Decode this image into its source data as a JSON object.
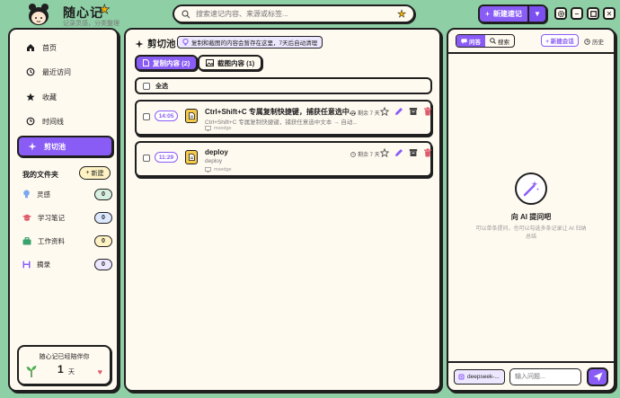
{
  "header": {
    "app_title": "随心记",
    "app_subtitle": "记录灵感，分类整理",
    "search_placeholder": "搜索速记内容、来源或标签...",
    "new_note_label": "新建速记"
  },
  "sidebar": {
    "nav": [
      {
        "label": "首页",
        "icon": "home-icon"
      },
      {
        "label": "最近访问",
        "icon": "clock-history-icon"
      },
      {
        "label": "收藏",
        "icon": "star-icon"
      },
      {
        "label": "时间线",
        "icon": "clock-icon"
      },
      {
        "label": "剪切池",
        "icon": "sparkle-icon",
        "active": true
      }
    ],
    "folders_title": "我的文件夹",
    "new_folder_label": "新建",
    "folders": [
      {
        "label": "灵感",
        "count": "0",
        "icon": "bulb-icon",
        "color": "#7aa8f0",
        "badge": "#d8f0e0"
      },
      {
        "label": "学习笔记",
        "count": "0",
        "icon": "cap-icon",
        "color": "#e05a6b",
        "badge": "#dde8ff"
      },
      {
        "label": "工作资料",
        "count": "0",
        "icon": "briefcase-icon",
        "color": "#3aa36b",
        "badge": "#fff3c4"
      },
      {
        "label": "摘录",
        "count": "0",
        "icon": "disk-icon",
        "color": "#8a5cf6",
        "badge": "#ede7ff"
      }
    ],
    "companion": {
      "title": "随心记已经陪伴你",
      "days": "1",
      "unit": "天"
    }
  },
  "clipboard": {
    "title": "剪切池",
    "notice": "复制和截图的内容会暂存在这里，7天后自动清理",
    "tabs": [
      {
        "label": "复制内容 (2)",
        "active": true
      },
      {
        "label": "截图内容 (1)",
        "active": false
      }
    ],
    "select_all": "全选",
    "items": [
      {
        "time": "14:05",
        "title": "Ctrl+Shift+C 专属复制快捷键，捕获任意选中...",
        "preview": "Ctrl+Shift+C 专属复制快捷键，捕获任意选中文本 → 自动...",
        "source": "msedge",
        "remaining": "剩余 7 天"
      },
      {
        "time": "11:29",
        "title": "deploy",
        "preview": "deploy",
        "source": "msedge",
        "remaining": "剩余 7 天"
      }
    ]
  },
  "assistant": {
    "tab_ask": "问答",
    "tab_search": "搜索",
    "new_chat": "+ 新建会话",
    "history": "历史",
    "empty_title": "向 AI 提问吧",
    "empty_desc": "可以单条提问，也可以勾选多条记录让 AI 归纳总结",
    "model": "deepseek-...",
    "input_placeholder": "输入问题..."
  },
  "colors": {
    "accent": "#8a5cf6",
    "background": "#8fcfa6",
    "panel": "#fffaf0",
    "danger": "#e05a6b"
  }
}
